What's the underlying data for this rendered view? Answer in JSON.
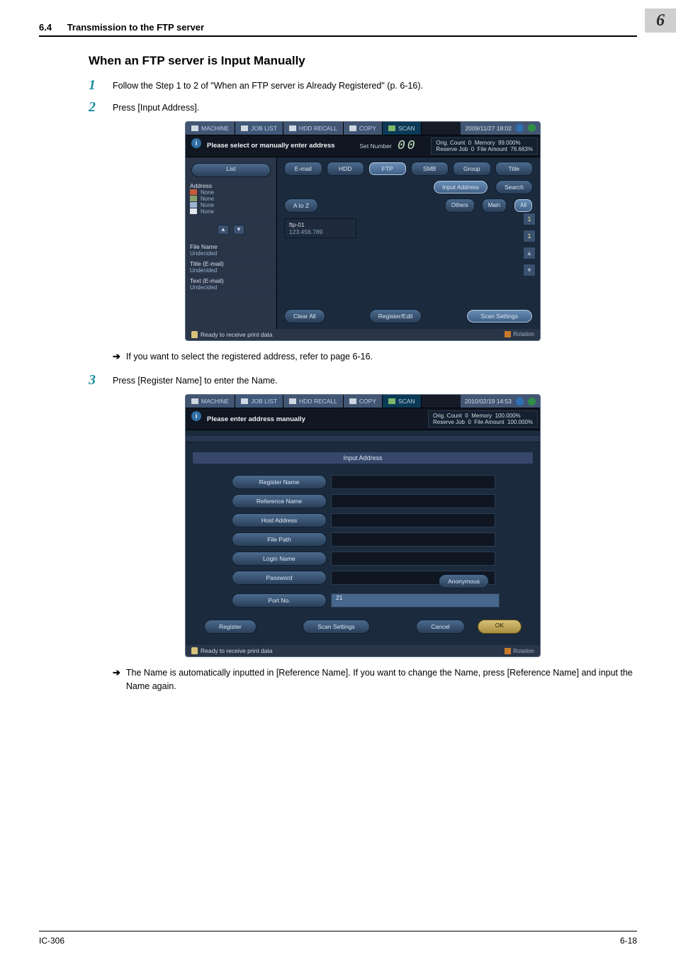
{
  "header": {
    "section_num": "6.4",
    "section_title": "Transmission to the FTP server",
    "chapter": "6"
  },
  "h2": "When an FTP server is Input Manually",
  "steps": {
    "s1": {
      "num": "1",
      "text": "Follow the Step 1 to 2 of \"When an FTP server is Already Registered\" (p. 6-16)."
    },
    "s2": {
      "num": "2",
      "text": "Press [Input Address]."
    },
    "s2_arrow": "If you want to select the registered address, refer to page 6-16.",
    "s3": {
      "num": "3",
      "text": "Press [Register Name] to enter the Name."
    },
    "s3_arrow": "The Name is automatically inputted in [Reference Name]. If you want to change the Name, press [Reference Name] and input the Name again."
  },
  "shot1": {
    "tabs": {
      "machine": "MACHINE",
      "joblist": "JOB LIST",
      "hdd": "HDD RECALL",
      "copy": "COPY",
      "scan": "SCAN"
    },
    "clock": "2009/11/27 18:02",
    "info": "Please select or manually enter address",
    "setnum_label": "Set Number",
    "setnum": "00",
    "status": {
      "l1a": "Orig. Count",
      "l1b": "0",
      "l1c": "Memory",
      "l1d": "99.000%",
      "l2a": "Reserve Job",
      "l2b": "0",
      "l2c": "File Amount",
      "l2d": "76.663%"
    },
    "left": {
      "list": "List",
      "address": "Address",
      "address_val": "None",
      "rows": [
        {
          "v": "None"
        },
        {
          "v": "None"
        },
        {
          "v": "None"
        }
      ],
      "file_name": "File Name",
      "file_name_v": "Undecided",
      "title": "Title (E-mail)",
      "title_v": "Undecided",
      "text": "Text (E-mail)",
      "text_v": "Undecided"
    },
    "tabbar": {
      "email": "E-mail",
      "hdd": "HDD",
      "ftp": "FTP",
      "smb": "SMB",
      "group": "Group",
      "title": "Title"
    },
    "actions": {
      "input": "Input Address",
      "search": "Search"
    },
    "filter": {
      "atoz": "A to Z",
      "others": "Others",
      "main": "Main",
      "all": "All"
    },
    "card": {
      "name": "ftp-01",
      "addr": "123.456.789"
    },
    "pager": {
      "top": "1",
      "bot": "1"
    },
    "bottom": {
      "clear": "Clear All",
      "register": "Register/Edit",
      "scan": "Scan Settings"
    },
    "foot": "Ready to receive print data",
    "rot": "Rotation"
  },
  "shot2": {
    "tabs": {
      "machine": "MACHINE",
      "joblist": "JOB LIST",
      "hdd": "HDD RECALL",
      "copy": "COPY",
      "scan": "SCAN"
    },
    "clock": "2010/02/19 14:53",
    "info": "Please enter address manually",
    "status": {
      "l1a": "Orig. Count",
      "l1b": "0",
      "l1c": "Memory",
      "l1d": "100.000%",
      "l2a": "Reserve Job",
      "l2b": "0",
      "l2c": "File Amount",
      "l2d": "100.000%"
    },
    "head": "Input Address",
    "fields": {
      "register_name": "Register Name",
      "reference_name": "Reference Name",
      "host_address": "Host Address",
      "file_path": "File Path",
      "login_name": "Login Name",
      "password": "Password",
      "port_no": "Port No.",
      "port_val": "21",
      "anonymous": "Anonymous"
    },
    "bottom": {
      "register": "Register",
      "scan": "Scan Settings",
      "cancel": "Cancel",
      "ok": "OK"
    },
    "foot": "Ready to receive print data",
    "rot": "Rotation"
  },
  "page_footer": {
    "left": "IC-306",
    "right": "6-18"
  }
}
